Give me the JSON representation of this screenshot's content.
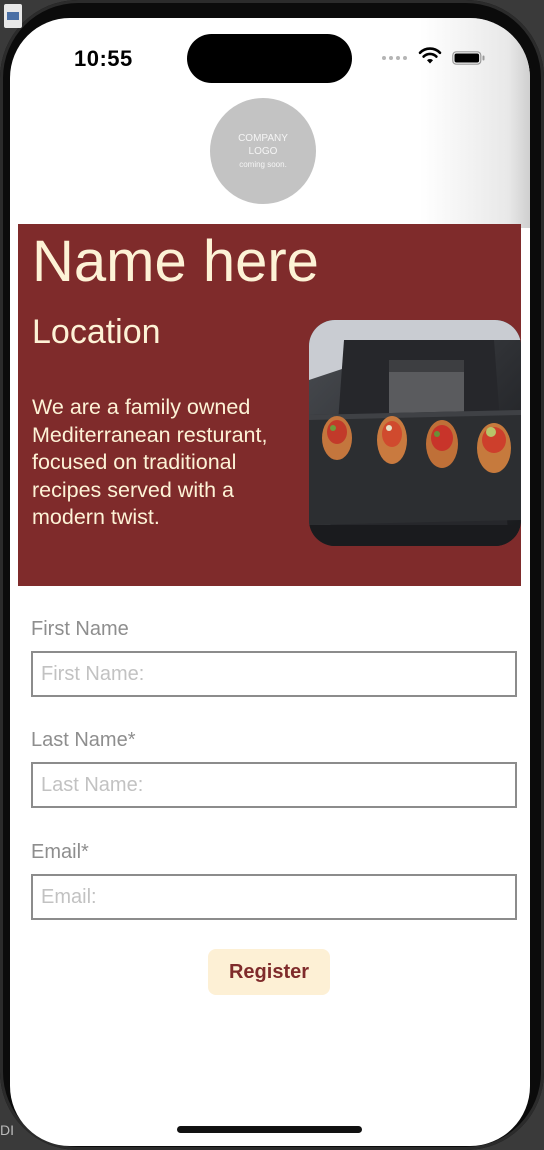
{
  "status_bar": {
    "time": "10:55",
    "icons": [
      "signal-dots-icon",
      "wifi-icon",
      "battery-icon"
    ]
  },
  "logo": {
    "line1": "COMPANY",
    "line2": "LOGO",
    "line3": "coming soon."
  },
  "hero": {
    "name": "Name here",
    "location": "Location",
    "description": "We are a family owned Mediterranean resturant, focused on traditional recipes served with a modern twist.",
    "photo_icon": "food-platter-photo"
  },
  "form": {
    "first_name": {
      "label": "First Name",
      "placeholder": "First Name:",
      "value": ""
    },
    "last_name": {
      "label": "Last Name*",
      "placeholder": "Last Name:",
      "value": ""
    },
    "email": {
      "label": "Email*",
      "placeholder": "Email:",
      "value": ""
    },
    "register_label": "Register"
  },
  "colors": {
    "hero_background": "#7f2b2b",
    "hero_text": "#fdf2d6",
    "button_background": "#fdf0d5",
    "button_text": "#7f2b2b",
    "label_text": "#8e8e8e",
    "logo_circle": "#c3c3c3"
  },
  "desktop": {
    "edge_text": "DI"
  }
}
